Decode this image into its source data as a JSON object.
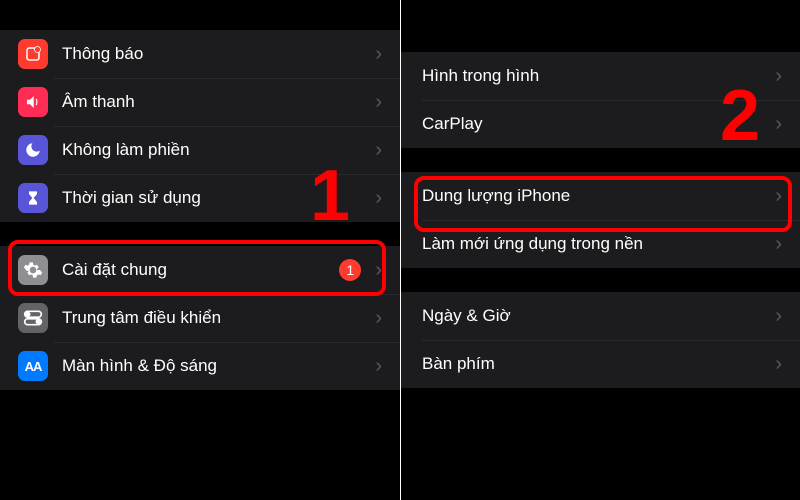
{
  "left": {
    "group1": [
      {
        "name": "notifications",
        "label": "Thông báo",
        "icon": "notification-icon",
        "iconBg": "bg-red"
      },
      {
        "name": "sounds",
        "label": "Âm thanh",
        "icon": "speaker-icon",
        "iconBg": "bg-pink"
      },
      {
        "name": "dnd",
        "label": "Không làm phiền",
        "icon": "moon-icon",
        "iconBg": "bg-purple"
      },
      {
        "name": "screentime",
        "label": "Thời gian sử dụng",
        "icon": "hourglass-icon",
        "iconBg": "bg-indigo"
      }
    ],
    "group2": [
      {
        "name": "general",
        "label": "Cài đặt chung",
        "icon": "gear-icon",
        "iconBg": "bg-gray",
        "badge": "1"
      },
      {
        "name": "controlcenter",
        "label": "Trung tâm điều khiển",
        "icon": "toggles-icon",
        "iconBg": "bg-darkgray"
      },
      {
        "name": "display",
        "label": "Màn hình & Độ sáng",
        "icon": "text-size-icon",
        "iconBg": "bg-blue"
      }
    ]
  },
  "right": {
    "group1": [
      {
        "name": "pip",
        "label": "Hình trong hình"
      },
      {
        "name": "carplay",
        "label": "CarPlay"
      }
    ],
    "group2": [
      {
        "name": "iphone-storage",
        "label": "Dung lượng iPhone"
      },
      {
        "name": "background-refresh",
        "label": "Làm mới ứng dụng trong nền"
      }
    ],
    "group3": [
      {
        "name": "date-time",
        "label": "Ngày & Giờ"
      },
      {
        "name": "keyboard",
        "label": "Bàn phím"
      }
    ]
  },
  "annotations": {
    "step1": "1",
    "step2": "2"
  }
}
